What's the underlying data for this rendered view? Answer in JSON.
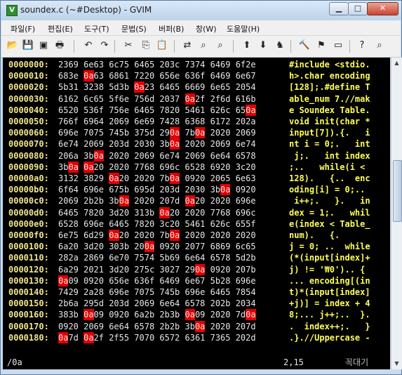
{
  "window": {
    "title": "soundex.c (~#Desktop) - GVIM",
    "app_icon": "vim-icon"
  },
  "titlebar_buttons": {
    "minimize": "▁",
    "maximize": "□",
    "close": "✕"
  },
  "menu": [
    "파일(F)",
    "편집(E)",
    "도구(T)",
    "문법(S)",
    "버퍼(B)",
    "창(W)",
    "도움말(H)"
  ],
  "toolbar_icons": [
    {
      "name": "open-file-icon",
      "glyph": "📂"
    },
    {
      "name": "save-icon",
      "glyph": "💾"
    },
    {
      "name": "save-all-icon",
      "glyph": "▣"
    },
    {
      "name": "print-icon",
      "glyph": "🖶"
    },
    {
      "name": "undo-icon",
      "glyph": "↶"
    },
    {
      "name": "redo-icon",
      "glyph": "↷"
    },
    {
      "name": "cut-icon",
      "glyph": "✂"
    },
    {
      "name": "copy-icon",
      "glyph": "⎘"
    },
    {
      "name": "paste-icon",
      "glyph": "📋"
    },
    {
      "name": "replace-icon",
      "glyph": "⇄"
    },
    {
      "name": "find-next-icon",
      "glyph": "⌕"
    },
    {
      "name": "find-prev-icon",
      "glyph": "⌕"
    },
    {
      "name": "load-session-icon",
      "glyph": "⬆"
    },
    {
      "name": "save-session-icon",
      "glyph": "⬇"
    },
    {
      "name": "run-script-icon",
      "glyph": "♞"
    },
    {
      "name": "make-icon",
      "glyph": "🔨"
    },
    {
      "name": "build-tags-icon",
      "glyph": "⚑"
    },
    {
      "name": "jump-tag-icon",
      "glyph": "▭"
    },
    {
      "name": "help-icon",
      "glyph": "?"
    },
    {
      "name": "find-help-icon",
      "glyph": "⌕"
    }
  ],
  "hexdump": [
    {
      "addr": "0000000:",
      "hex": "2369 6e63 6c75 6465 203c 7374 6469 6f2e",
      "ascii": "#include <stdio."
    },
    {
      "addr": "0000010:",
      "hex": "683e 0a63 6861 7220 656e 636f 6469 6e67",
      "ascii": "h>.char encoding"
    },
    {
      "addr": "0000020:",
      "hex": "5b31 3238 5d3b 0a23 6465 6669 6e65 2054",
      "ascii": "[128];.#define T"
    },
    {
      "addr": "0000030:",
      "hex": "6162 6c65 5f6e 756d 2037 0a2f 2f6d 616b",
      "ascii": "able_num 7.//mak"
    },
    {
      "addr": "0000040:",
      "hex": "6520 536f 756e 6465 7820 5461 626c 650a",
      "ascii": "e Soundex Table."
    },
    {
      "addr": "0000050:",
      "hex": "766f 6964 2069 6e69 7428 6368 6172 202a",
      "ascii": "void init(char *"
    },
    {
      "addr": "0000060:",
      "hex": "696e 7075 745b 375d 290a 7b0a 2020 2069",
      "ascii": "input[7]).{.   i"
    },
    {
      "addr": "0000070:",
      "hex": "6e74 2069 203d 2030 3b0a 2020 2069 6e74",
      "ascii": "nt i = 0;.   int"
    },
    {
      "addr": "0000080:",
      "hex": "206a 3b0a 2020 2069 6e74 2069 6e64 6578",
      "ascii": " j;.   int index"
    },
    {
      "addr": "0000090:",
      "hex": "3b0a 0a20 2020 7768 696c 6528 6920 3c20",
      "ascii": ";..   while(i < "
    },
    {
      "addr": "00000a0:",
      "hex": "3132 3829 0a20 2020 7b0a 0920 2065 6e63",
      "ascii": "128).   {..  enc"
    },
    {
      "addr": "00000b0:",
      "hex": "6f64 696e 675b 695d 203d 2030 3b0a 0920",
      "ascii": "oding[i] = 0;.. "
    },
    {
      "addr": "00000c0:",
      "hex": "2069 2b2b 3b0a 2020 207d 0a20 2020 696e",
      "ascii": " i++;.   }.   in"
    },
    {
      "addr": "00000d0:",
      "hex": "6465 7820 3d20 313b 0a20 2020 7768 696c",
      "ascii": "dex = 1;.   whil"
    },
    {
      "addr": "00000e0:",
      "hex": "6528 696e 6465 7820 3c20 5461 626c 655f",
      "ascii": "e(index < Table_"
    },
    {
      "addr": "00000f0:",
      "hex": "6e75 6d29 0a20 2020 7b0a 2020 2020 2020",
      "ascii": "num).   {.      "
    },
    {
      "addr": "0000100:",
      "hex": "6a20 3d20 303b 200a 0920 2077 6869 6c65",
      "ascii": "j = 0; ..  while"
    },
    {
      "addr": "0000110:",
      "hex": "282a 2869 6e70 7574 5b69 6e64 6578 5d2b",
      "ascii": "(*(input[index]+"
    },
    {
      "addr": "0000120:",
      "hex": "6a29 2021 3d20 275c 3027 290a 0920 207b",
      "ascii": "j) != '₩0').. {"
    },
    {
      "addr": "0000130:",
      "hex": "0a09 0920 656e 636f 6469 6e67 5b28 696e",
      "ascii": "... encoding[(in"
    },
    {
      "addr": "0000140:",
      "hex": "7429 2a28 696e 7075 745b 696e 6465 7854",
      "ascii": "t)*(input[index]"
    },
    {
      "addr": "0000150:",
      "hex": "2b6a 295d 203d 2069 6e64 6578 202b 2034",
      "ascii": "+j)] = index + 4"
    },
    {
      "addr": "0000160:",
      "hex": "383b 0a09 0920 6a2b 2b3b 0a09 2020 7d0a",
      "ascii": "8;... j++;..  }."
    },
    {
      "addr": "0000170:",
      "hex": "0920 2069 6e64 6578 2b2b 3b0a 2020 207d",
      "ascii": ".  index++;.   }"
    },
    {
      "addr": "0000180:",
      "hex": "0a7d 0a2f 2f55 7070 6572 6361 7365 202d",
      "ascii": ".}.//Uppercase -"
    }
  ],
  "highlight_byte": "0a",
  "status": {
    "command": "/0a",
    "position": "2,15",
    "mode": "꼭대기"
  }
}
